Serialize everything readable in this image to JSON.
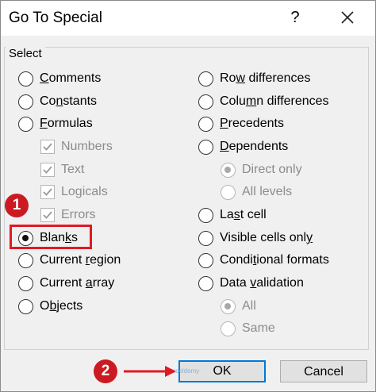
{
  "dialog": {
    "title": "Go To Special",
    "help_glyph": "?",
    "group_label": "Select"
  },
  "left_options": [
    {
      "pre": "",
      "ul": "C",
      "post": "omments",
      "kind": "radio",
      "selected": false,
      "disabled": false
    },
    {
      "pre": "Co",
      "ul": "n",
      "post": "stants",
      "kind": "radio",
      "selected": false,
      "disabled": false
    },
    {
      "pre": "",
      "ul": "F",
      "post": "ormulas",
      "kind": "radio",
      "selected": false,
      "disabled": false
    },
    {
      "pre": "",
      "ul": "",
      "post": "Numbers",
      "kind": "check",
      "checked": true,
      "disabled": true
    },
    {
      "pre": "",
      "ul": "",
      "post": "Text",
      "kind": "check",
      "checked": true,
      "disabled": true
    },
    {
      "pre": "",
      "ul": "",
      "post": "Logicals",
      "kind": "check",
      "checked": true,
      "disabled": true
    },
    {
      "pre": "",
      "ul": "",
      "post": "Errors",
      "kind": "check",
      "checked": true,
      "disabled": true
    },
    {
      "pre": "Blan",
      "ul": "k",
      "post": "s",
      "kind": "radio",
      "selected": true,
      "disabled": false
    },
    {
      "pre": "Current ",
      "ul": "r",
      "post": "egion",
      "kind": "radio",
      "selected": false,
      "disabled": false
    },
    {
      "pre": "Current ",
      "ul": "a",
      "post": "rray",
      "kind": "radio",
      "selected": false,
      "disabled": false
    },
    {
      "pre": "O",
      "ul": "b",
      "post": "jects",
      "kind": "radio",
      "selected": false,
      "disabled": false
    }
  ],
  "right_options": [
    {
      "pre": "Ro",
      "ul": "w",
      "post": " differences",
      "kind": "radio",
      "selected": false,
      "disabled": false
    },
    {
      "pre": "Colu",
      "ul": "m",
      "post": "n differences",
      "kind": "radio",
      "selected": false,
      "disabled": false
    },
    {
      "pre": "",
      "ul": "P",
      "post": "recedents",
      "kind": "radio",
      "selected": false,
      "disabled": false
    },
    {
      "pre": "",
      "ul": "D",
      "post": "ependents",
      "kind": "radio",
      "selected": false,
      "disabled": false
    },
    {
      "pre": "",
      "ul": "",
      "post": "Direct only",
      "kind": "radio",
      "selected": true,
      "disabled": true
    },
    {
      "pre": "",
      "ul": "",
      "post": "All levels",
      "kind": "radio",
      "selected": false,
      "disabled": true
    },
    {
      "pre": "La",
      "ul": "s",
      "post": "t cell",
      "kind": "radio",
      "selected": false,
      "disabled": false
    },
    {
      "pre": "Visible cells onl",
      "ul": "y",
      "post": "",
      "kind": "radio",
      "selected": false,
      "disabled": false
    },
    {
      "pre": "Condi",
      "ul": "t",
      "post": "ional formats",
      "kind": "radio",
      "selected": false,
      "disabled": false
    },
    {
      "pre": "Data ",
      "ul": "v",
      "post": "alidation",
      "kind": "radio",
      "selected": false,
      "disabled": false
    },
    {
      "pre": "",
      "ul": "",
      "post": "All",
      "kind": "radio",
      "selected": true,
      "disabled": true
    },
    {
      "pre": "",
      "ul": "",
      "post": "Same",
      "kind": "radio",
      "selected": false,
      "disabled": true
    }
  ],
  "buttons": {
    "ok": "OK",
    "cancel": "Cancel"
  },
  "annotations": {
    "step1": "1",
    "step2": "2",
    "accent_color": "#e01a22"
  },
  "watermark": "exceldemy"
}
